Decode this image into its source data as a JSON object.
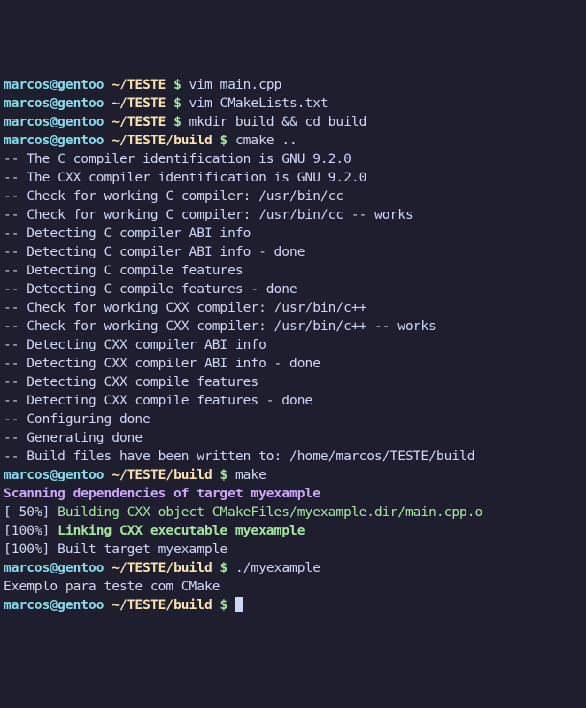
{
  "prompts": [
    {
      "userhost": "marcos@gentoo",
      "path": "~/TESTE",
      "symbol": "$",
      "cmd": "vim main.cpp"
    },
    {
      "userhost": "marcos@gentoo",
      "path": "~/TESTE",
      "symbol": "$",
      "cmd": "vim CMakeLists.txt"
    },
    {
      "userhost": "marcos@gentoo",
      "path": "~/TESTE",
      "symbol": "$",
      "cmd": "mkdir build && cd build"
    },
    {
      "userhost": "marcos@gentoo",
      "path": "~/TESTE/build",
      "symbol": "$",
      "cmd": "cmake .."
    }
  ],
  "cmake_output": [
    "-- The C compiler identification is GNU 9.2.0",
    "-- The CXX compiler identification is GNU 9.2.0",
    "-- Check for working C compiler: /usr/bin/cc",
    "-- Check for working C compiler: /usr/bin/cc -- works",
    "-- Detecting C compiler ABI info",
    "-- Detecting C compiler ABI info - done",
    "-- Detecting C compile features",
    "-- Detecting C compile features - done",
    "-- Check for working CXX compiler: /usr/bin/c++",
    "-- Check for working CXX compiler: /usr/bin/c++ -- works",
    "-- Detecting CXX compiler ABI info",
    "-- Detecting CXX compiler ABI info - done",
    "-- Detecting CXX compile features",
    "-- Detecting CXX compile features - done",
    "-- Configuring done",
    "-- Generating done",
    "-- Build files have been written to: /home/marcos/TESTE/build"
  ],
  "prompt_make": {
    "userhost": "marcos@gentoo",
    "path": "~/TESTE/build",
    "symbol": "$",
    "cmd": "make"
  },
  "make_scanning": "Scanning dependencies of target myexample",
  "make_build_pct": "[ 50%] ",
  "make_build_txt": "Building CXX object CMakeFiles/myexample.dir/main.cpp.o",
  "make_link_pct": "[100%] ",
  "make_link_txt": "Linking CXX executable myexample",
  "make_built": "[100%] Built target myexample",
  "prompt_run": {
    "userhost": "marcos@gentoo",
    "path": "~/TESTE/build",
    "symbol": "$",
    "cmd": "./myexample"
  },
  "run_output": "Exemplo para teste com CMake",
  "prompt_final": {
    "userhost": "marcos@gentoo",
    "path": "~/TESTE/build",
    "symbol": "$",
    "cmd": ""
  }
}
